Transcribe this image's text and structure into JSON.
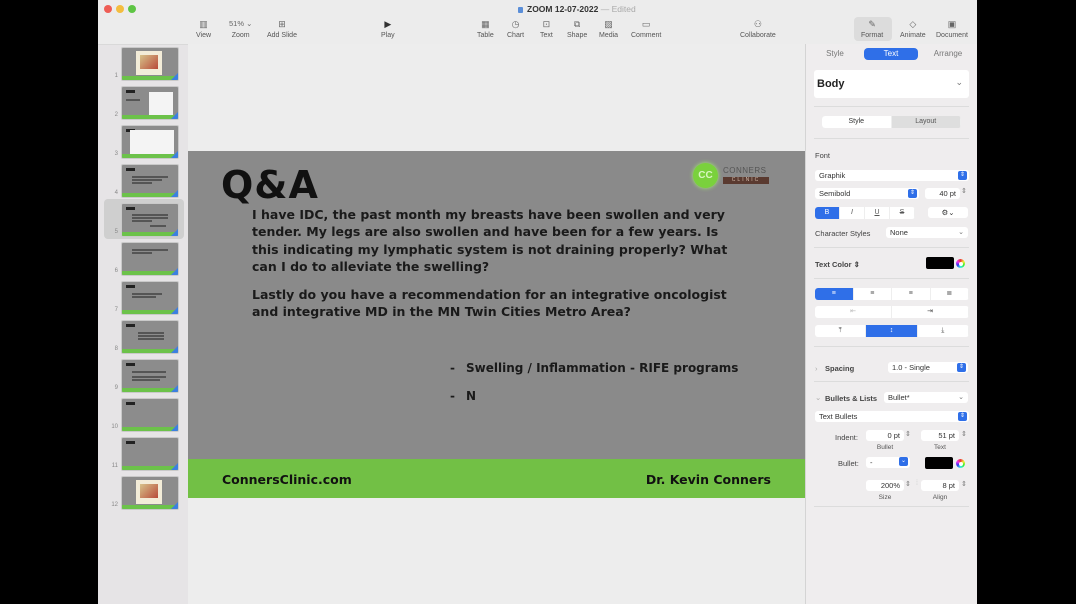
{
  "window": {
    "title": "ZOOM 12-07-2022",
    "title_status": "— Edited"
  },
  "toolbar": {
    "items": [
      {
        "label": "View",
        "icon": "sidebar-icon"
      },
      {
        "label": "Zoom",
        "value": "51% ⌄",
        "icon": "zoom-dropdown"
      },
      {
        "label": "Add Slide",
        "icon": "add-slide-icon"
      },
      {
        "label": "Play",
        "icon": "play-icon"
      },
      {
        "label": "Table",
        "icon": "table-icon"
      },
      {
        "label": "Chart",
        "icon": "chart-icon"
      },
      {
        "label": "Text",
        "icon": "text-box-icon"
      },
      {
        "label": "Shape",
        "icon": "shape-icon"
      },
      {
        "label": "Media",
        "icon": "media-icon"
      },
      {
        "label": "Comment",
        "icon": "comment-icon"
      },
      {
        "label": "Collaborate",
        "icon": "collaborate-icon"
      },
      {
        "label": "Format",
        "icon": "paintbrush-icon"
      },
      {
        "label": "Animate",
        "icon": "animate-icon"
      },
      {
        "label": "Document",
        "icon": "document-icon"
      }
    ]
  },
  "navigator": {
    "selected_slide": 5,
    "slides": [
      {
        "number": "1",
        "kind": "image"
      },
      {
        "number": "2",
        "kind": "qa-document"
      },
      {
        "number": "3",
        "kind": "qa-screenshot"
      },
      {
        "number": "4",
        "kind": "qa-text"
      },
      {
        "number": "5",
        "kind": "qa-text"
      },
      {
        "number": "6",
        "kind": "qa-text"
      },
      {
        "number": "7",
        "kind": "qa-text"
      },
      {
        "number": "8",
        "kind": "qa-text"
      },
      {
        "number": "9",
        "kind": "qa-text"
      },
      {
        "number": "10",
        "kind": "qa-blank"
      },
      {
        "number": "11",
        "kind": "qa-blank"
      },
      {
        "number": "12",
        "kind": "image"
      }
    ]
  },
  "slide": {
    "title": "Q&A",
    "question_paragraphs": [
      "I have IDC, the past month my breasts have been swollen and very tender. My legs are also swollen and have been for a few years. Is this indicating my lymphatic system is not draining properly? What can I do to alleviate the swelling?",
      "Lastly do you have a recommendation for an integrative oncologist and integrative MD in the MN Twin Cities Metro Area?"
    ],
    "bullets": [
      {
        "marker": "-",
        "text": "Swelling / Inflammation - RIFE programs"
      },
      {
        "marker": "-",
        "text": "N"
      }
    ],
    "logo": {
      "initials": "CC",
      "word": "CONNERS",
      "sub": "CLINIC"
    },
    "footer_left": "ConnersClinic.com",
    "footer_right": "Dr. Kevin Conners",
    "colors": {
      "background": "#8a8a8a",
      "footer": "#72c045",
      "logo_green": "#7ad13c"
    }
  },
  "inspector": {
    "tabs": [
      "Style",
      "Text",
      "Arrange"
    ],
    "active_tab": "Text",
    "paragraph_style": "Body",
    "subtabs": [
      "Style",
      "Layout"
    ],
    "active_subtab": "Style",
    "font_section_label": "Font",
    "font_family": "Graphik",
    "font_typeface": "Semibold",
    "font_size": "40 pt",
    "format_buttons": [
      "B",
      "I",
      "U",
      "S"
    ],
    "active_format": "B",
    "gear_label": "⚙⌄",
    "character_styles_label": "Character Styles",
    "character_styles_value": "None",
    "text_color_label": "Text Color ⇕",
    "text_color": "#000000",
    "alignment": [
      "align-left",
      "align-center",
      "align-right",
      "justify"
    ],
    "active_alignment": "align-left",
    "indent_buttons": [
      "decrease-indent",
      "increase-indent"
    ],
    "vertical_alignment": [
      "top",
      "middle",
      "bottom"
    ],
    "active_vertical": "middle",
    "spacing_label": "Spacing",
    "spacing_value": "1.0 - Single",
    "bullets_label": "Bullets & Lists",
    "bullets_value": "Bullet*",
    "bullet_type": "Text Bullets",
    "indent_label": "Indent:",
    "indent_bullet_value": "0 pt",
    "indent_text_value": "51 pt",
    "indent_bullet_caption": "Bullet",
    "indent_text_caption": "Text",
    "bullet_label": "Bullet:",
    "bullet_char": "-",
    "bullet_color": "#000000",
    "size_value": "200%",
    "align_value": "8 pt",
    "size_caption": "Size",
    "align_caption": "Align"
  }
}
